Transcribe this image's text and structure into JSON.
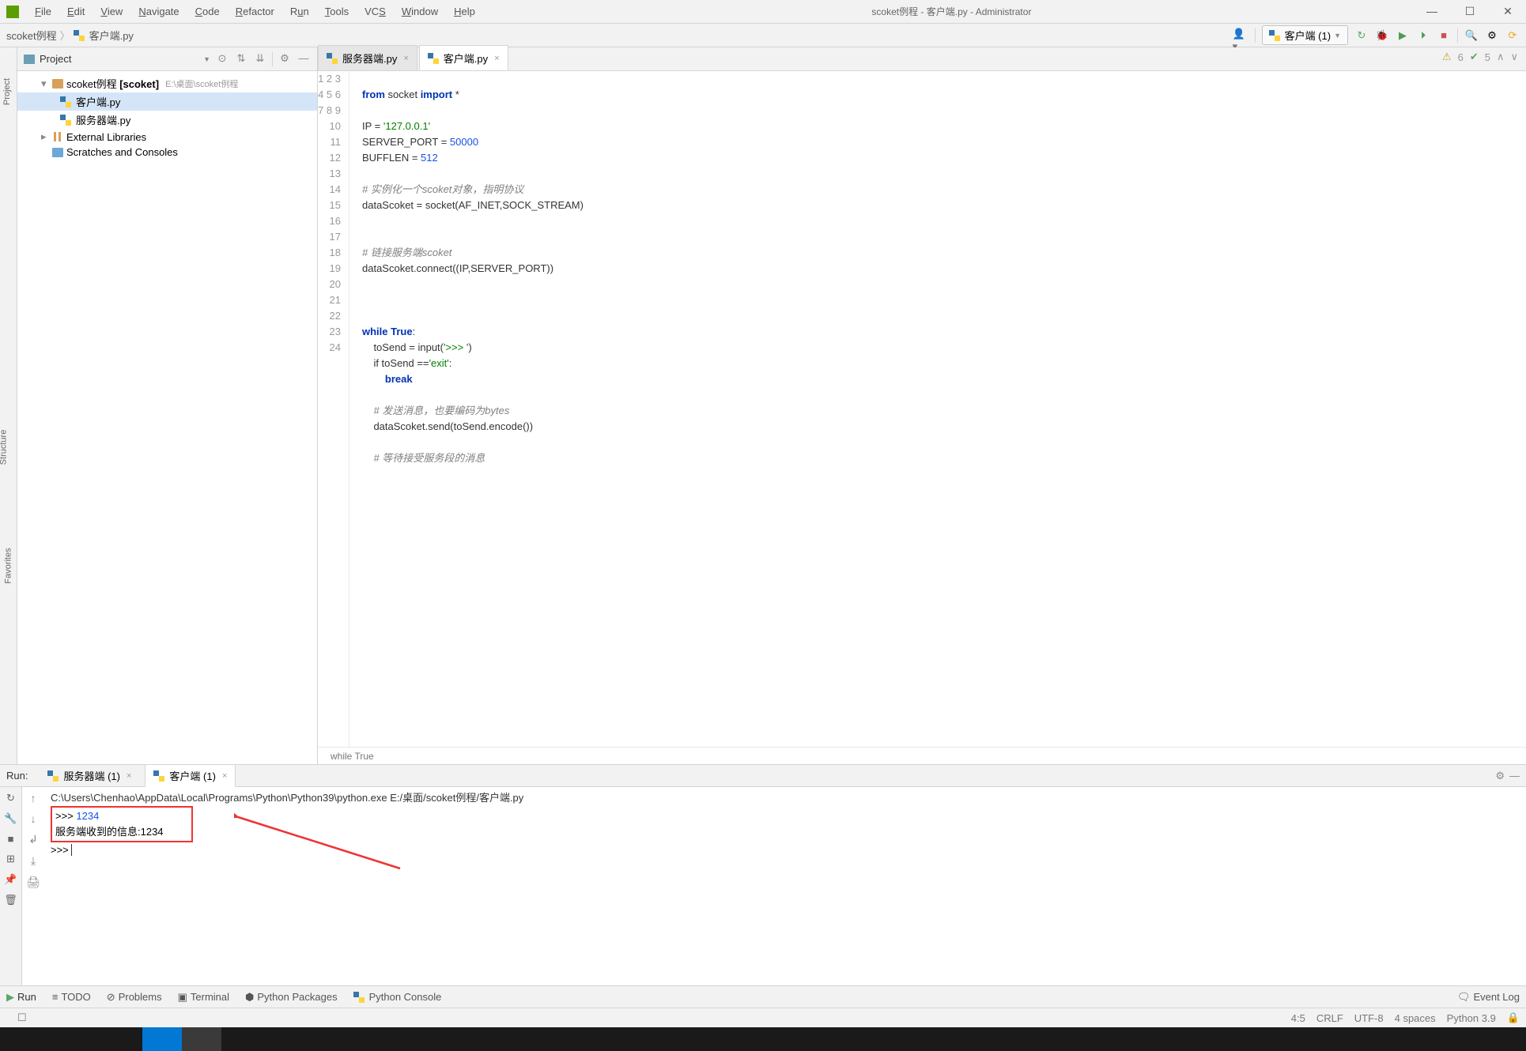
{
  "title": "scoket例程 - 客户端.py - Administrator",
  "menu": [
    "File",
    "Edit",
    "View",
    "Navigate",
    "Code",
    "Refactor",
    "Run",
    "Tools",
    "VCS",
    "Window",
    "Help"
  ],
  "breadcrumb": {
    "root": "scoket例程",
    "file": "客户端.py"
  },
  "run_config": "客户端 (1)",
  "project": {
    "title": "Project",
    "root": "scoket例程",
    "root_bold": "[scoket]",
    "root_path": "E:\\桌面\\scoket例程",
    "files": [
      "客户端.py",
      "服务器端.py"
    ],
    "extlibs": "External Libraries",
    "scratches": "Scratches and Consoles"
  },
  "tabs": {
    "t1": "服务器端.py",
    "t2": "客户端.py"
  },
  "code": {
    "lines_count": 24,
    "l1": "from socket import *",
    "l3a": "IP = ",
    "l3b": "'127.0.0.1'",
    "l4a": "SERVER_PORT = ",
    "l4b": "50000",
    "l5a": "BUFFLEN = ",
    "l5b": "512",
    "l7": "# 实例化一个scoket对象，指明协议",
    "l8": "dataScoket = socket(AF_INET,SOCK_STREAM)",
    "l11": "# 链接服务端scoket",
    "l12": "dataScoket.connect((IP,SERVER_PORT))",
    "l16a": "while ",
    "l16b": "True",
    "l16c": ":",
    "l17a": "    toSend = input(",
    "l17b": "'>>> '",
    "l17c": ")",
    "l18a": "    if toSend ==",
    "l18b": "'exit'",
    "l18c": ":",
    "l19": "        break",
    "l21": "    # 发送消息，也要编码为bytes",
    "l22": "    dataScoket.send(toSend.encode())",
    "l24": "    # 等待接受服务段的消息",
    "crumb": "while True"
  },
  "inspection": {
    "warnings": "6",
    "passes": "5"
  },
  "run": {
    "label": "Run:",
    "tab1": "服务器端 (1)",
    "tab2": "客户端 (1)",
    "cmd": "C:\\Users\\Chenhao\\AppData\\Local\\Programs\\Python\\Python39\\python.exe E:/桌面/scoket例程/客户端.py",
    "out1": ">>> 1234",
    "out2": "服务端收到的信息:1234",
    "out3": ">>> "
  },
  "bottom": {
    "run": "Run",
    "todo": "TODO",
    "problems": "Problems",
    "terminal": "Terminal",
    "pypkg": "Python Packages",
    "pycons": "Python Console",
    "eventlog": "Event Log"
  },
  "status": {
    "pos": "4:5",
    "crlf": "CRLF",
    "enc": "UTF-8",
    "indent": "4 spaces",
    "interp": "Python 3.9"
  },
  "sidebar": {
    "project": "Project",
    "structure": "Structure",
    "favorites": "Favorites"
  }
}
